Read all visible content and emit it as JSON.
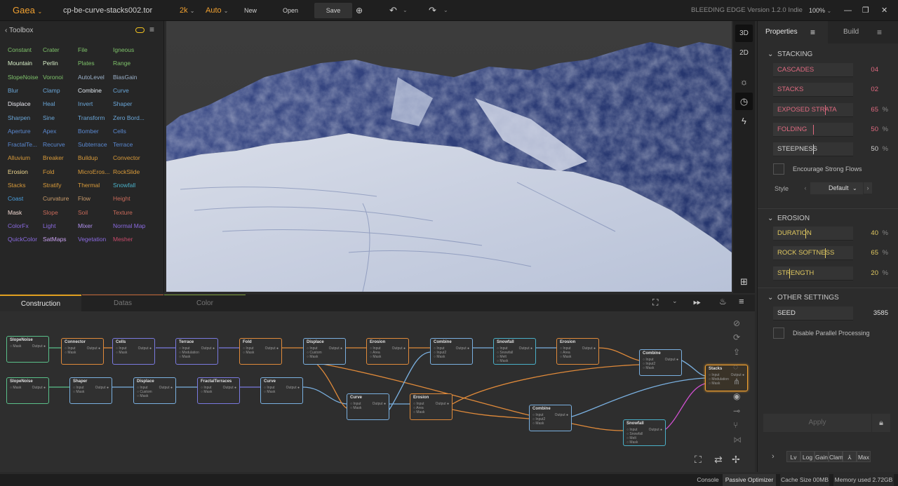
{
  "topbar": {
    "app_name": "Gaea",
    "file_name": "cp-be-curve-stacks002.tor",
    "resolution": "2k",
    "mode": "Auto",
    "new_label": "New",
    "open_label": "Open",
    "save_label": "Save",
    "version": "BLEEDING EDGE Version 1.2.0 Indie",
    "zoom": "100%"
  },
  "toolbox": {
    "title": "Toolbox",
    "columns": [
      [
        {
          "label": "Constant",
          "color": "#7ec26a"
        },
        {
          "label": "Mountain",
          "color": "#d8f0c8"
        },
        {
          "label": "SlopeNoise",
          "color": "#7ec26a"
        },
        {
          "label": "Blur",
          "color": "#6aa6d8"
        },
        {
          "label": "Displace",
          "color": "#e8e8f0"
        },
        {
          "label": "Sharpen",
          "color": "#6aa6d8"
        },
        {
          "label": "Aperture",
          "color": "#5a88d0"
        },
        {
          "label": "FractalTe...",
          "color": "#5a88d0"
        },
        {
          "label": "Alluvium",
          "color": "#d89a3a"
        },
        {
          "label": "Erosion",
          "color": "#f0d890"
        },
        {
          "label": "Stacks",
          "color": "#d89a3a"
        },
        {
          "label": "Coast",
          "color": "#4aa0e0"
        },
        {
          "label": "Mask",
          "color": "#f0d8d0"
        },
        {
          "label": "ColorFx",
          "color": "#8a6ae0"
        },
        {
          "label": "QuickColor",
          "color": "#8a6ae0"
        }
      ],
      [
        {
          "label": "Crater",
          "color": "#7ec26a"
        },
        {
          "label": "Perlin",
          "color": "#d8f0c8"
        },
        {
          "label": "Voronoi",
          "color": "#7ec26a"
        },
        {
          "label": "Clamp",
          "color": "#6aa6d8"
        },
        {
          "label": "Heal",
          "color": "#6aa6d8"
        },
        {
          "label": "Sine",
          "color": "#6aa6d8"
        },
        {
          "label": "Apex",
          "color": "#5a88d0"
        },
        {
          "label": "Recurve",
          "color": "#5a88d0"
        },
        {
          "label": "Breaker",
          "color": "#d89a3a"
        },
        {
          "label": "Fold",
          "color": "#d89a3a"
        },
        {
          "label": "Stratify",
          "color": "#d89a3a"
        },
        {
          "label": "Curvature",
          "color": "#c89a6a"
        },
        {
          "label": "Slope",
          "color": "#c86a5a"
        },
        {
          "label": "Light",
          "color": "#8a6ae0"
        },
        {
          "label": "SatMaps",
          "color": "#c8a0f0"
        }
      ],
      [
        {
          "label": "File",
          "color": "#7ec26a"
        },
        {
          "label": "Plates",
          "color": "#7ec26a"
        },
        {
          "label": "AutoLevel",
          "color": "#9ab0c8"
        },
        {
          "label": "Combine",
          "color": "#e0e8f0"
        },
        {
          "label": "Invert",
          "color": "#6aa6d8"
        },
        {
          "label": "Transform",
          "color": "#6aa6d8"
        },
        {
          "label": "Bomber",
          "color": "#5a88d0"
        },
        {
          "label": "Subterrace",
          "color": "#5a88d0"
        },
        {
          "label": "Buildup",
          "color": "#d89a3a"
        },
        {
          "label": "MicroEros...",
          "color": "#d89a3a"
        },
        {
          "label": "Thermal",
          "color": "#d89a3a"
        },
        {
          "label": "Flow",
          "color": "#c89a6a"
        },
        {
          "label": "Soil",
          "color": "#c86a5a"
        },
        {
          "label": "Mixer",
          "color": "#b090f0"
        },
        {
          "label": "Vegetation",
          "color": "#8a6ae0"
        }
      ],
      [
        {
          "label": "Igneous",
          "color": "#7ec26a"
        },
        {
          "label": "Range",
          "color": "#7ec26a"
        },
        {
          "label": "BiasGain",
          "color": "#9ab0c8"
        },
        {
          "label": "Curve",
          "color": "#6aa6d8"
        },
        {
          "label": "Shaper",
          "color": "#6aa6d8"
        },
        {
          "label": "Zero Bord...",
          "color": "#6aa6d8"
        },
        {
          "label": "Cells",
          "color": "#5a88d0"
        },
        {
          "label": "Terrace",
          "color": "#5a88d0"
        },
        {
          "label": "Convector",
          "color": "#d89a3a"
        },
        {
          "label": "RockSlide",
          "color": "#d89a3a"
        },
        {
          "label": "Snowfall",
          "color": "#4ab0c8"
        },
        {
          "label": "Height",
          "color": "#c86a5a"
        },
        {
          "label": "Texture",
          "color": "#c86a5a"
        },
        {
          "label": "Normal Map",
          "color": "#8a6ae0"
        },
        {
          "label": "Mesher",
          "color": "#c84a6a"
        }
      ]
    ]
  },
  "viewport": {
    "mode_3d": "3D",
    "mode_2d": "2D"
  },
  "properties": {
    "tab_properties": "Properties",
    "tab_build": "Build",
    "stacking_title": "STACKING",
    "stacking_fields": [
      {
        "label": "CASCADES",
        "value": "04",
        "unit": "",
        "color": "#e06a80",
        "fill": 0.0
      },
      {
        "label": "STACKS",
        "value": "02",
        "unit": "",
        "color": "#e06a80",
        "fill": 0.0
      },
      {
        "label": "EXPOSED STRATA",
        "value": "65",
        "unit": "%",
        "color": "#e06a80",
        "fill": 0.65
      },
      {
        "label": "FOLDING",
        "value": "50",
        "unit": "%",
        "color": "#e06a80",
        "fill": 0.5
      },
      {
        "label": "STEEPNESS",
        "value": "50",
        "unit": "%",
        "color": "#d0d0d0",
        "fill": 0.5
      }
    ],
    "encourage_label": "Encourage Strong Flows",
    "style_label": "Style",
    "style_value": "Default",
    "erosion_title": "EROSION",
    "erosion_fields": [
      {
        "label": "DURATION",
        "value": "40",
        "unit": "%",
        "color": "#e0c860",
        "fill": 0.4
      },
      {
        "label": "ROCK SOFTNESS",
        "value": "65",
        "unit": "%",
        "color": "#e0c860",
        "fill": 0.65
      },
      {
        "label": "STRENGTH",
        "value": "20",
        "unit": "%",
        "color": "#e0c860",
        "fill": 0.2
      }
    ],
    "other_title": "OTHER SETTINGS",
    "seed_label": "SEED",
    "seed_value": "3585",
    "parallel_label": "Disable Parallel Processing",
    "apply_label": "Apply",
    "bottom_buttons": [
      "Lv",
      "Log",
      "Gain",
      "Clam",
      "⅄",
      "Max"
    ]
  },
  "graph": {
    "tab_construction": "Construction",
    "tab_datas": "Datas",
    "tab_color": "Color"
  },
  "statusbar": {
    "console": "Console",
    "optimizer": "Passive Optimizer",
    "cache": "Cache Size 00MB",
    "memory": "Memory used 2.72GB"
  }
}
